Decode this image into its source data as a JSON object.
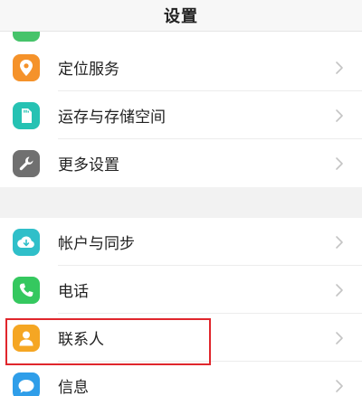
{
  "header": {
    "title": "设置"
  },
  "colors": {
    "location": "#f5922a",
    "storage": "#26c2b3",
    "more": "#707070",
    "accounts": "#2fbfc9",
    "phone": "#35c85f",
    "contacts": "#f5a623",
    "messages": "#2f9ee9",
    "partial": "#46c36a",
    "highlight": "#e0262c"
  },
  "groups": [
    {
      "items": [
        {
          "label": "定位服务",
          "icon": "location-pin-icon"
        },
        {
          "label": "运存与存储空间",
          "icon": "memory-card-icon"
        },
        {
          "label": "更多设置",
          "icon": "wrench-icon"
        }
      ]
    },
    {
      "items": [
        {
          "label": "帐户与同步",
          "icon": "cloud-sync-icon"
        },
        {
          "label": "电话",
          "icon": "phone-icon"
        },
        {
          "label": "联系人",
          "icon": "contact-person-icon"
        },
        {
          "label": "信息",
          "icon": "message-bubble-icon"
        }
      ]
    }
  ]
}
